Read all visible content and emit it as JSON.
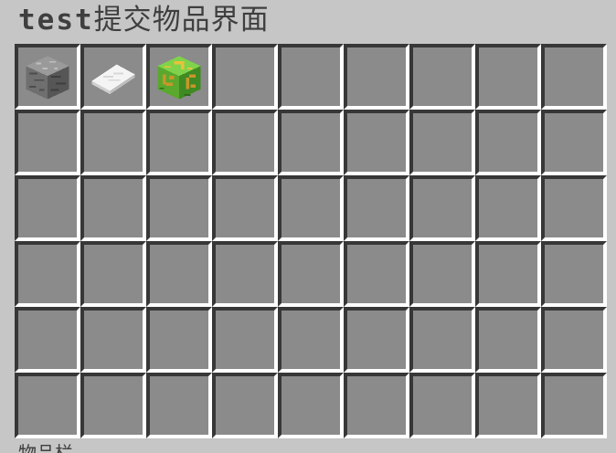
{
  "window": {
    "title_latin": "test",
    "title_cjk": "提交物品界面"
  },
  "inventory": {
    "rows": 6,
    "columns": 9,
    "items": [
      {
        "slot": 0,
        "name": "stone-block",
        "icon": "stone-block-icon"
      },
      {
        "slot": 1,
        "name": "paper",
        "icon": "paper-icon"
      },
      {
        "slot": 2,
        "name": "green-gold-ornate-block",
        "icon": "ornate-green-block-icon"
      }
    ]
  },
  "footer": {
    "label": "物品栏"
  }
}
